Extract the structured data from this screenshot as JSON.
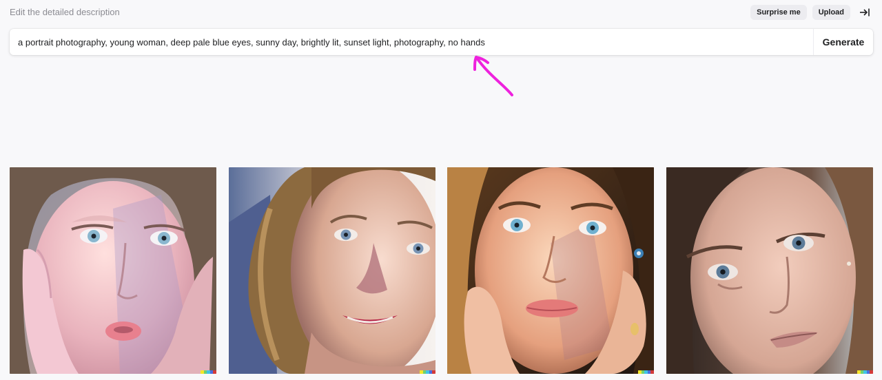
{
  "header": {
    "hint": "Edit the detailed description",
    "surprise_label": "Surprise me",
    "upload_label": "Upload",
    "collapse_icon": "arrow-right-to-bar-icon"
  },
  "prompt": {
    "value": "a portrait photography, young woman, deep pale blue eyes, sunny day, brightly lit, sunset light, photography, no hands",
    "generate_label": "Generate"
  },
  "annotation": {
    "color": "#ee22dd",
    "icon": "hand-drawn-arrow-icon"
  },
  "results": {
    "images": [
      {
        "subject": "portrait-1"
      },
      {
        "subject": "portrait-2"
      },
      {
        "subject": "portrait-3"
      },
      {
        "subject": "portrait-4"
      }
    ],
    "signature_colors": [
      "#f5e62a",
      "#6fd16f",
      "#3fc3e6",
      "#4a6ee0",
      "#d43a3a"
    ]
  }
}
